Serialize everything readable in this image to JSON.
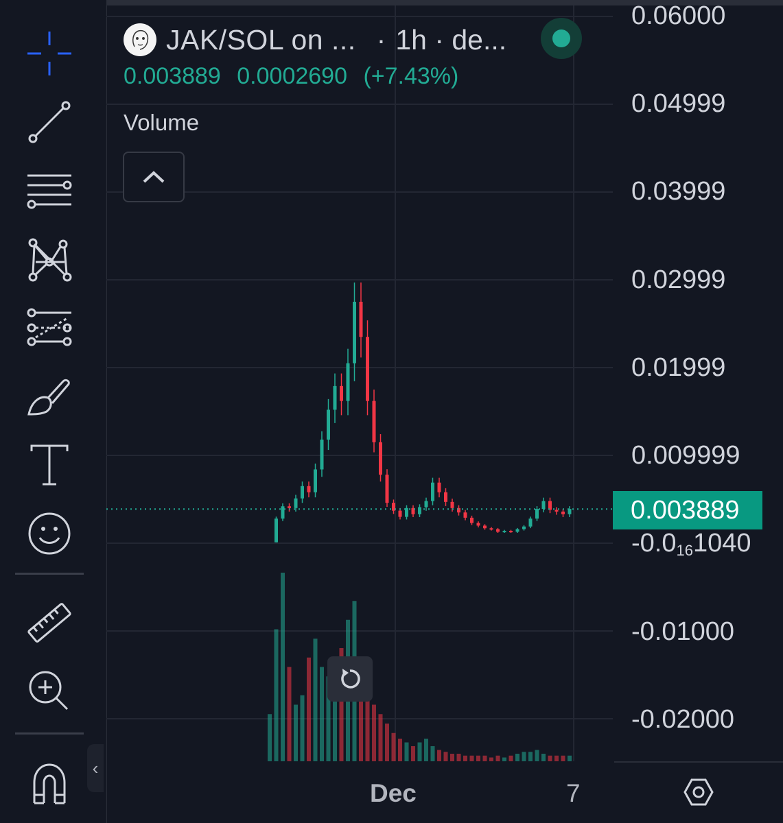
{
  "header": {
    "symbol_title": "JAK/SOL on ...",
    "separator": "·",
    "timeframe": "1h · de...",
    "status": "live"
  },
  "legend": {
    "price": "0.003889",
    "change": "0.0002690",
    "change_pct": "(+7.43%)"
  },
  "volume": {
    "label": "Volume",
    "toggle_icon": "chevron-up-icon"
  },
  "price_axis": {
    "labels": [
      "0.06000",
      "0.04999",
      "0.03999",
      "0.02999",
      "0.01999",
      "0.009999"
    ],
    "zero_label_prefix": "-0.0",
    "zero_label_sub": "16",
    "zero_label_suffix": "1040",
    "negative_labels": [
      "-0.01000",
      "-0.02000"
    ],
    "last_price": "0.003889"
  },
  "time_axis": {
    "labels": [
      "Dec",
      "7"
    ]
  },
  "toolbar": {
    "items": [
      {
        "name": "crosshair-icon",
        "active": true
      },
      {
        "name": "trend-line-icon"
      },
      {
        "name": "horizontal-lines-icon"
      },
      {
        "name": "pattern-icon"
      },
      {
        "name": "forecast-icon"
      },
      {
        "name": "brush-icon"
      },
      {
        "name": "text-icon"
      },
      {
        "name": "emoji-icon"
      },
      {
        "name": "ruler-icon"
      },
      {
        "name": "zoom-in-icon"
      },
      {
        "name": "magnet-icon"
      }
    ],
    "collapse_icon": "chevron-left-icon"
  },
  "colors": {
    "background": "#131722",
    "up": "#22ab94",
    "down": "#f23645",
    "accent": "#2962ff",
    "badge": "#089981"
  },
  "chart_data": {
    "type": "candlestick",
    "interval": "1h",
    "x_labels": [
      "Dec",
      "7"
    ],
    "y_range": [
      -0.02,
      0.06
    ],
    "price_close_series": [
      0.0001,
      0.0028,
      0.0042,
      0.004,
      0.0051,
      0.0065,
      0.0058,
      0.0084,
      0.0118,
      0.0152,
      0.0179,
      0.0162,
      0.0205,
      0.0275,
      0.0235,
      0.0162,
      0.0115,
      0.0078,
      0.0046,
      0.0037,
      0.003,
      0.004,
      0.0033,
      0.0041,
      0.0048,
      0.0069,
      0.0058,
      0.0047,
      0.004,
      0.0035,
      0.0029,
      0.0023,
      0.002,
      0.0017,
      0.0016,
      0.0013,
      0.0014,
      0.0013,
      0.0016,
      0.0019,
      0.0028,
      0.0039,
      0.0048,
      0.0038,
      0.0036,
      0.0033,
      0.0039
    ],
    "last_price": 0.003889,
    "change": 0.000269,
    "change_pct": 7.43,
    "volume_relative": [
      0.25,
      0.7,
      1.0,
      0.5,
      0.3,
      0.35,
      0.55,
      0.65,
      0.5,
      0.45,
      0.55,
      0.6,
      0.75,
      0.85,
      0.55,
      0.4,
      0.3,
      0.25,
      0.2,
      0.15,
      0.12,
      0.1,
      0.08,
      0.1,
      0.12,
      0.08,
      0.06,
      0.05,
      0.04,
      0.04,
      0.03,
      0.03,
      0.03,
      0.03,
      0.02,
      0.03,
      0.02,
      0.03,
      0.04,
      0.05,
      0.05,
      0.06,
      0.04,
      0.03,
      0.03,
      0.03,
      0.03
    ]
  }
}
